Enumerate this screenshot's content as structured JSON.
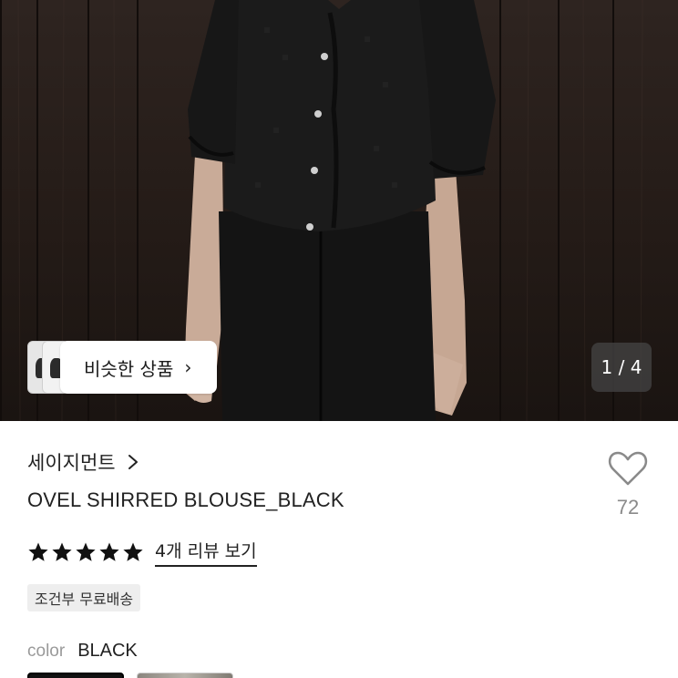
{
  "gallery": {
    "similar_label": "비슷한 상품",
    "similar_chevron": "›",
    "counter": "1 / 4",
    "current_page": 1,
    "total_pages": 4
  },
  "product": {
    "brand": "세이지먼트",
    "name": "OVEL SHIRRED BLOUSE_BLACK",
    "wish_count": "72",
    "rating": 5,
    "review_link": "4개 리뷰 보기",
    "shipping_badge": "조건부 무료배송",
    "color_label": "color",
    "color_value": "BLACK"
  },
  "icons": {
    "heart": "heart-icon",
    "star": "star-icon",
    "chevron": "chevron-right-icon"
  },
  "colors": {
    "star": "#111111",
    "counter_bg": "#464646",
    "badge_bg": "#eeeeee",
    "muted_text": "#8a8a8a"
  }
}
